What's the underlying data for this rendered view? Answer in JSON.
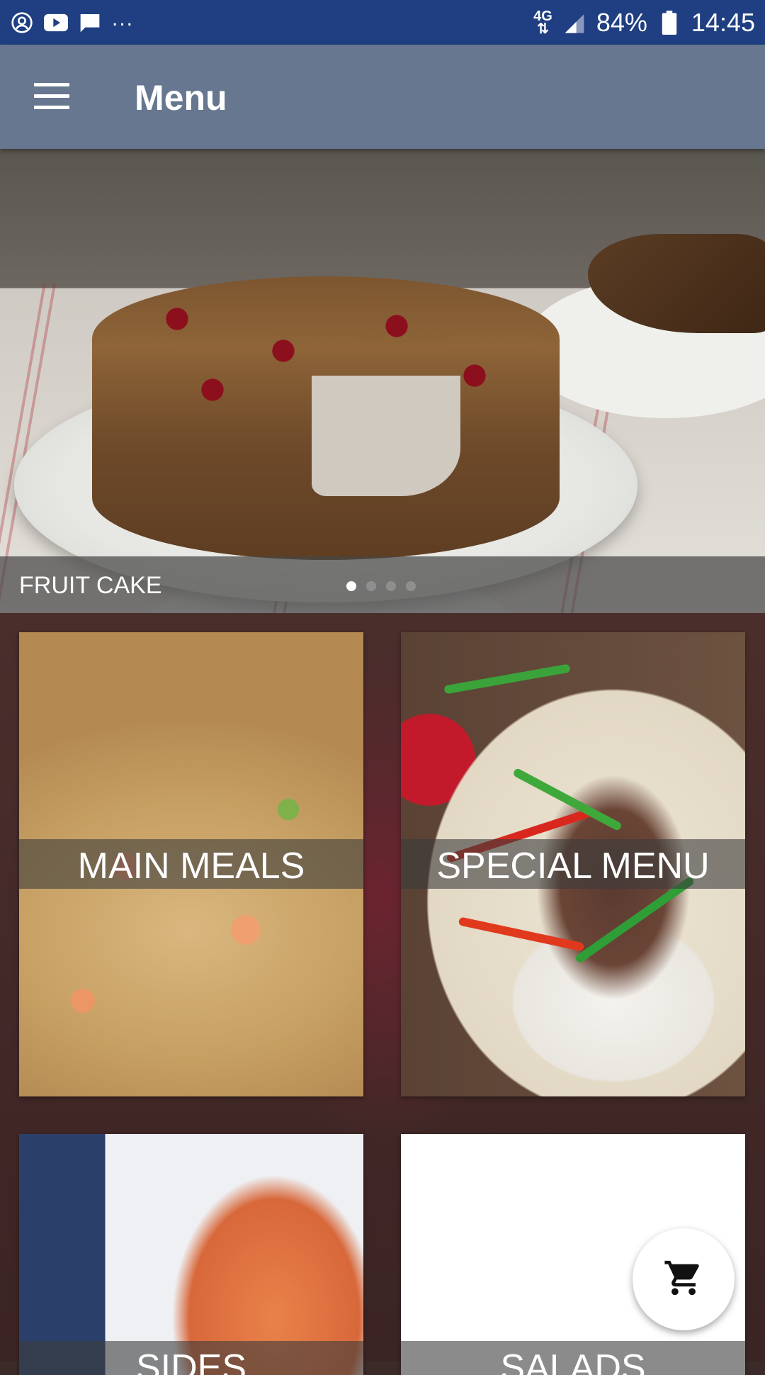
{
  "status_bar": {
    "more": "...",
    "network": "4G",
    "battery": "84%",
    "time": "14:45"
  },
  "app_bar": {
    "title": "Menu"
  },
  "hero": {
    "caption": "FRUIT CAKE",
    "slide_count": 4,
    "active_slide": 1
  },
  "categories": [
    {
      "label": "MAIN MEALS"
    },
    {
      "label": "SPECIAL MENU"
    },
    {
      "label": "SIDES"
    },
    {
      "label": "SALADS"
    }
  ],
  "icons": {
    "status_left": [
      "account-circle-icon",
      "youtube-icon",
      "message-icon"
    ],
    "status_right": [
      "network-4g-icon",
      "signal-icon",
      "battery-icon"
    ],
    "menu": "hamburger-menu-icon",
    "fab": "cart-icon"
  },
  "colors": {
    "status_bar": "#1f3f82",
    "app_bar": "#66778f"
  }
}
